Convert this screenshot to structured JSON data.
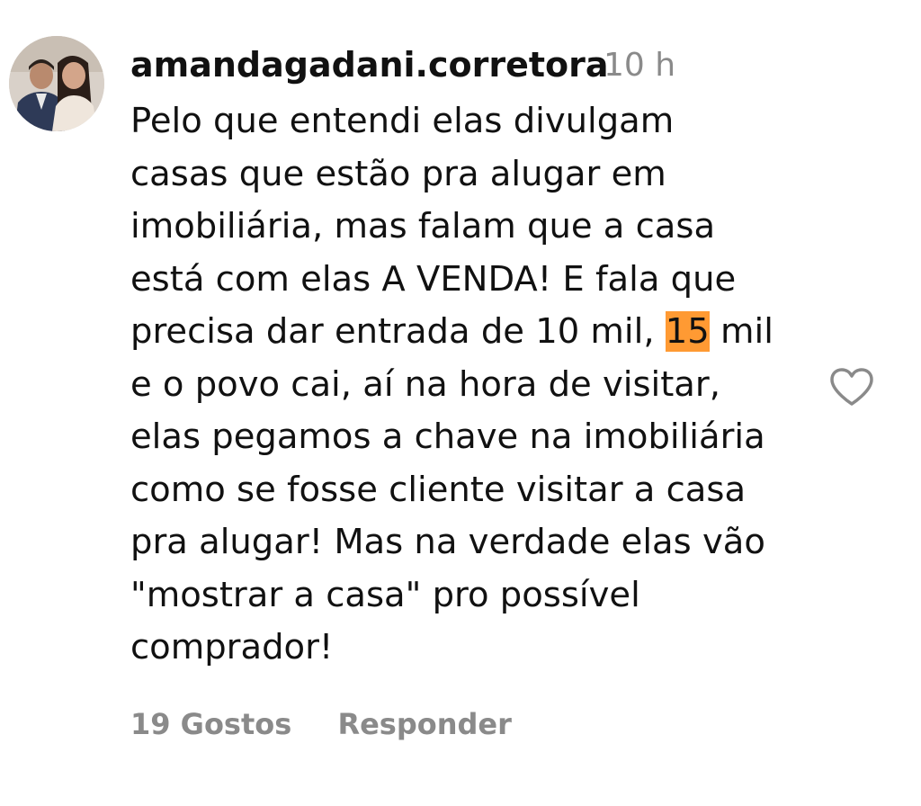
{
  "comment": {
    "username": "amandagadani.corretora",
    "timestamp": "10 h",
    "lines": [
      {
        "text": "Pelo que entendi elas divulgam"
      },
      {
        "text": "casas que estão pra alugar em"
      },
      {
        "text": "imobiliária, mas falam que a casa"
      },
      {
        "text": "está com elas A VENDA! E fala que"
      },
      {
        "before": "precisa dar entrada de 10 mil, ",
        "highlight": "15",
        "after": " mil"
      },
      {
        "text": "e o povo cai, aí na hora de visitar,"
      },
      {
        "text": "elas pegamos a chave na imobiliária"
      },
      {
        "text": "como se fosse cliente visitar a casa"
      },
      {
        "text": "pra alugar! Mas na verdade elas vão"
      },
      {
        "text": "\"mostrar a casa\" pro possível"
      },
      {
        "text": "comprador!"
      }
    ],
    "likes_label": "19 Gostos",
    "reply_label": "Responder",
    "like_icon": "heart-outline-icon"
  },
  "colors": {
    "text": "#111111",
    "meta": "#8a8a8a",
    "highlight": "#ff9a33"
  }
}
